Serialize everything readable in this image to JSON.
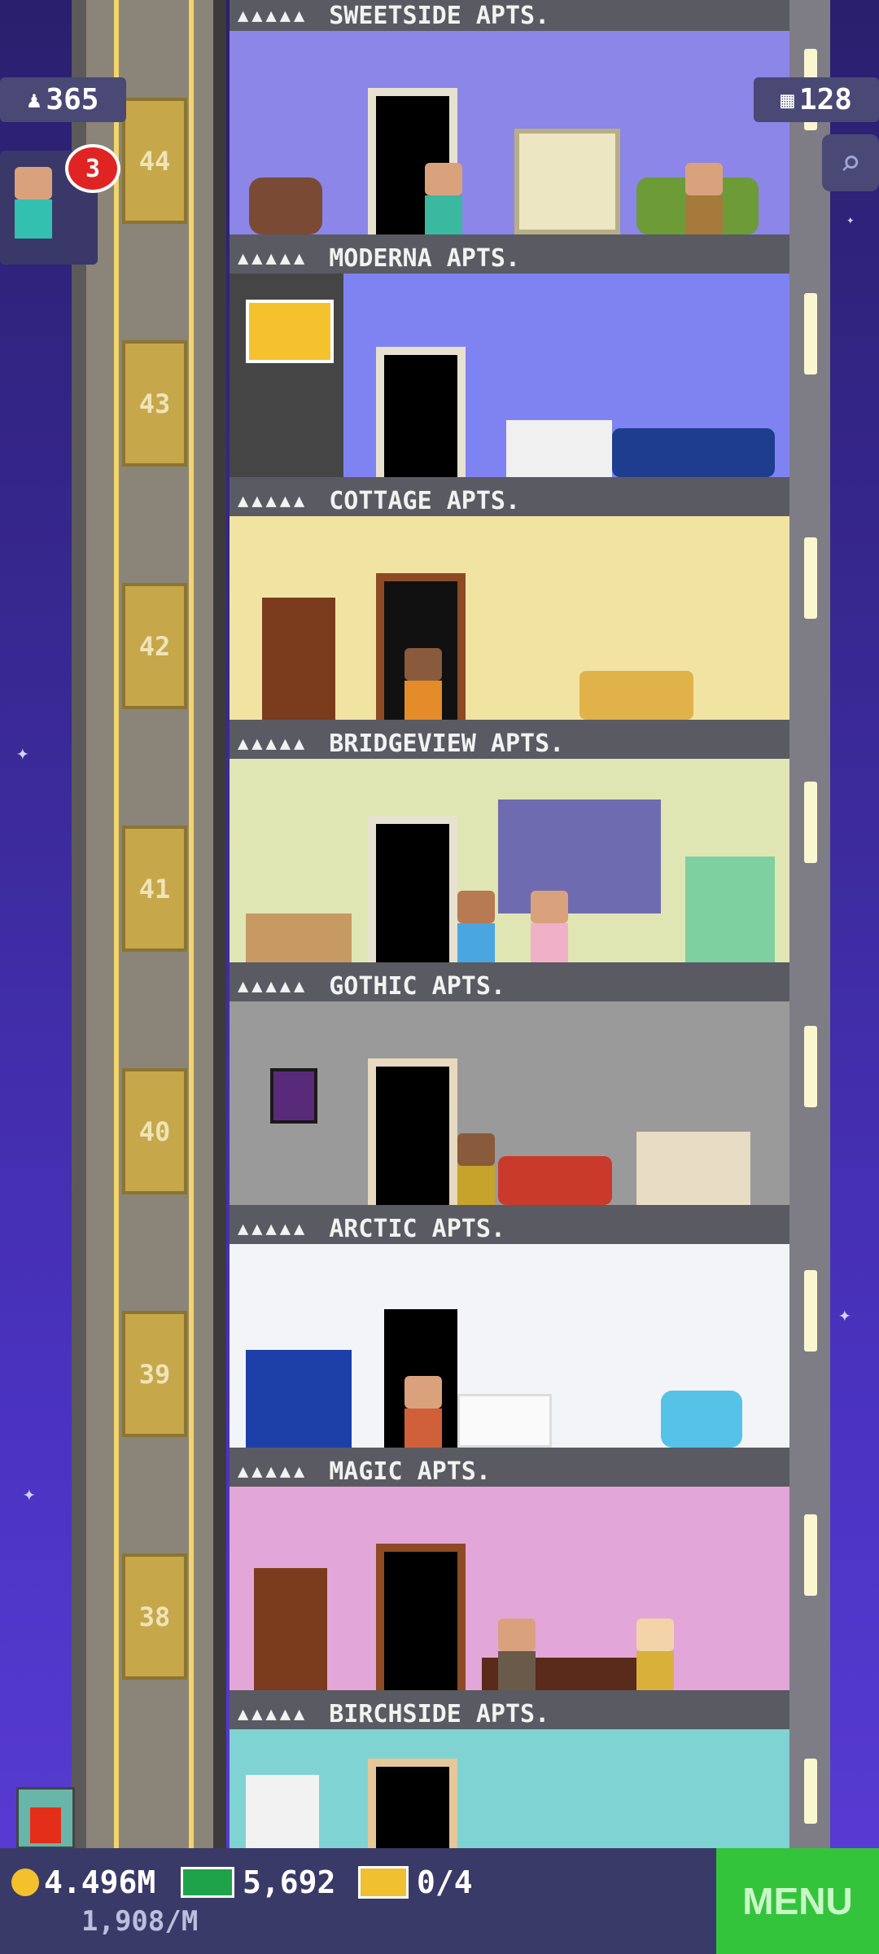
{
  "hud": {
    "population": "365",
    "floor_count": "128",
    "notification_count": "3"
  },
  "elevator": {
    "floors": [
      "44",
      "43",
      "42",
      "41",
      "40",
      "39",
      "38"
    ]
  },
  "floors": [
    {
      "name": "SWEETSIDE APTS.",
      "wall": "#8b86e8"
    },
    {
      "name": "MODERNA APTS.",
      "wall": "#7f83f2"
    },
    {
      "name": "COTTAGE APTS.",
      "wall": "#f1e4a3"
    },
    {
      "name": "BRIDGEVIEW APTS.",
      "wall": "#dfe6b4"
    },
    {
      "name": "GOTHIC APTS.",
      "wall": "#9a9a9a"
    },
    {
      "name": "ARCTIC APTS.",
      "wall": "#f3f4f8"
    },
    {
      "name": "MAGIC APTS.",
      "wall": "#e3a6d8"
    },
    {
      "name": "BIRCHSIDE APTS.",
      "wall": "#7fd3d3"
    }
  ],
  "stars_label": "▲▲▲▲▲",
  "bottom": {
    "coins": "4.496M",
    "rate": "1,908/M",
    "bux": "5,692",
    "tickets": "0/4",
    "menu_label": "MENU"
  },
  "icons": {
    "population": "person-icon",
    "floors": "building-icon",
    "search": "magnifier-icon",
    "coin": "coin-icon",
    "bux": "bux-icon",
    "ticket": "ticket-icon"
  }
}
